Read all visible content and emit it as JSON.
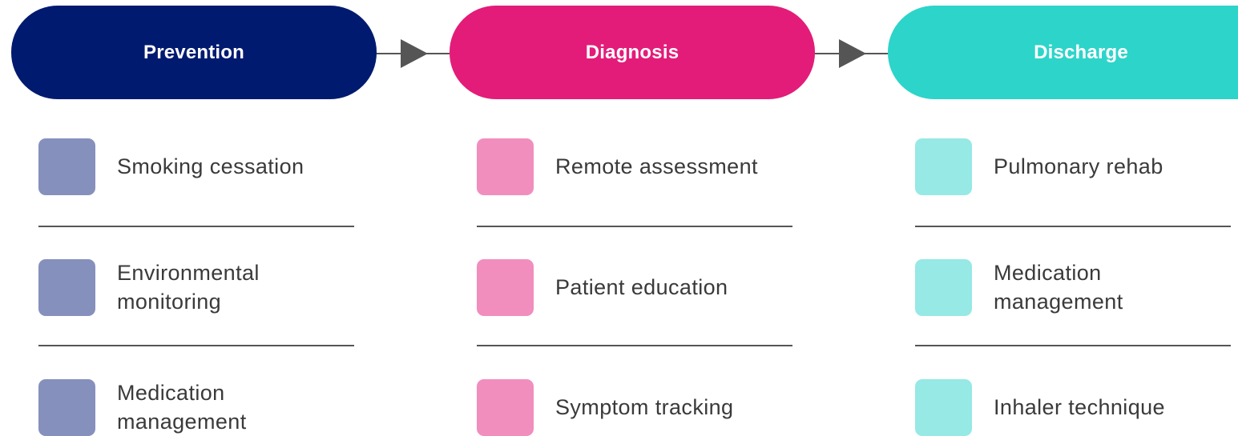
{
  "colors": {
    "prevention": "#001a70",
    "prevention_swatch": "#8590bc",
    "diagnosis": "#e31c79",
    "diagnosis_swatch": "#f18ebd",
    "discharge": "#2dd4c9",
    "discharge_swatch": "#96e9e4",
    "connector": "#555555"
  },
  "stages": [
    {
      "title": "Prevention",
      "items": [
        "Smoking cessation",
        "Environmental\nmonitoring",
        "Medication\nmanagement"
      ]
    },
    {
      "title": "Diagnosis",
      "items": [
        "Remote assessment",
        "Patient education",
        "Symptom tracking"
      ]
    },
    {
      "title": "Discharge",
      "items": [
        "Pulmonary rehab",
        "Medication\nmanagement",
        "Inhaler technique"
      ]
    }
  ]
}
